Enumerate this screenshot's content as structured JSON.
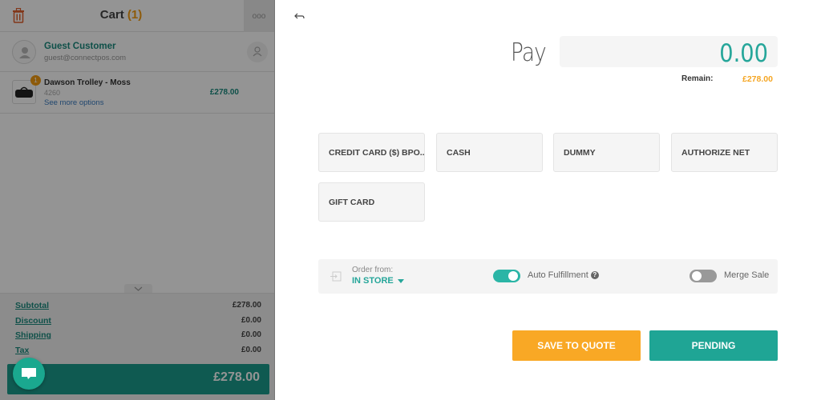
{
  "cart": {
    "title": "Cart",
    "count": "(1)",
    "more_icon": "ooo",
    "customer": {
      "name": "Guest Customer",
      "email": "guest@connectpos.com"
    },
    "items": [
      {
        "qty": "1",
        "name": "Dawson Trolley - Moss",
        "sku": "4260",
        "more_link": "See more options",
        "price": "£278.00"
      }
    ],
    "summary": [
      {
        "label": "Subtotal",
        "value": "£278.00"
      },
      {
        "label": "Discount",
        "value": "£0.00"
      },
      {
        "label": "Shipping",
        "value": "£0.00"
      },
      {
        "label": "Tax",
        "value": "£0.00"
      }
    ],
    "total": "£278.00"
  },
  "payment": {
    "pay_label": "Pay",
    "pay_value": "0.00",
    "remain_label": "Remain:",
    "remain_value": "£278.00",
    "methods": [
      "CREDIT CARD ($) BPO...",
      "CASH",
      "DUMMY",
      "AUTHORIZE NET",
      "GIFT CARD"
    ],
    "order_from_label": "Order from:",
    "order_from_value": "IN STORE",
    "auto_fulfillment_label": "Auto Fulfillment",
    "auto_fulfillment_on": true,
    "merge_sale_label": "Merge Sale",
    "merge_sale_on": false,
    "help_icon": "?",
    "save_quote_label": "SAVE TO QUOTE",
    "pending_label": "PENDING"
  },
  "colors": {
    "teal": "#26a69a",
    "orange": "#f5a623",
    "accent_dark_teal": "#1a9c8c"
  }
}
